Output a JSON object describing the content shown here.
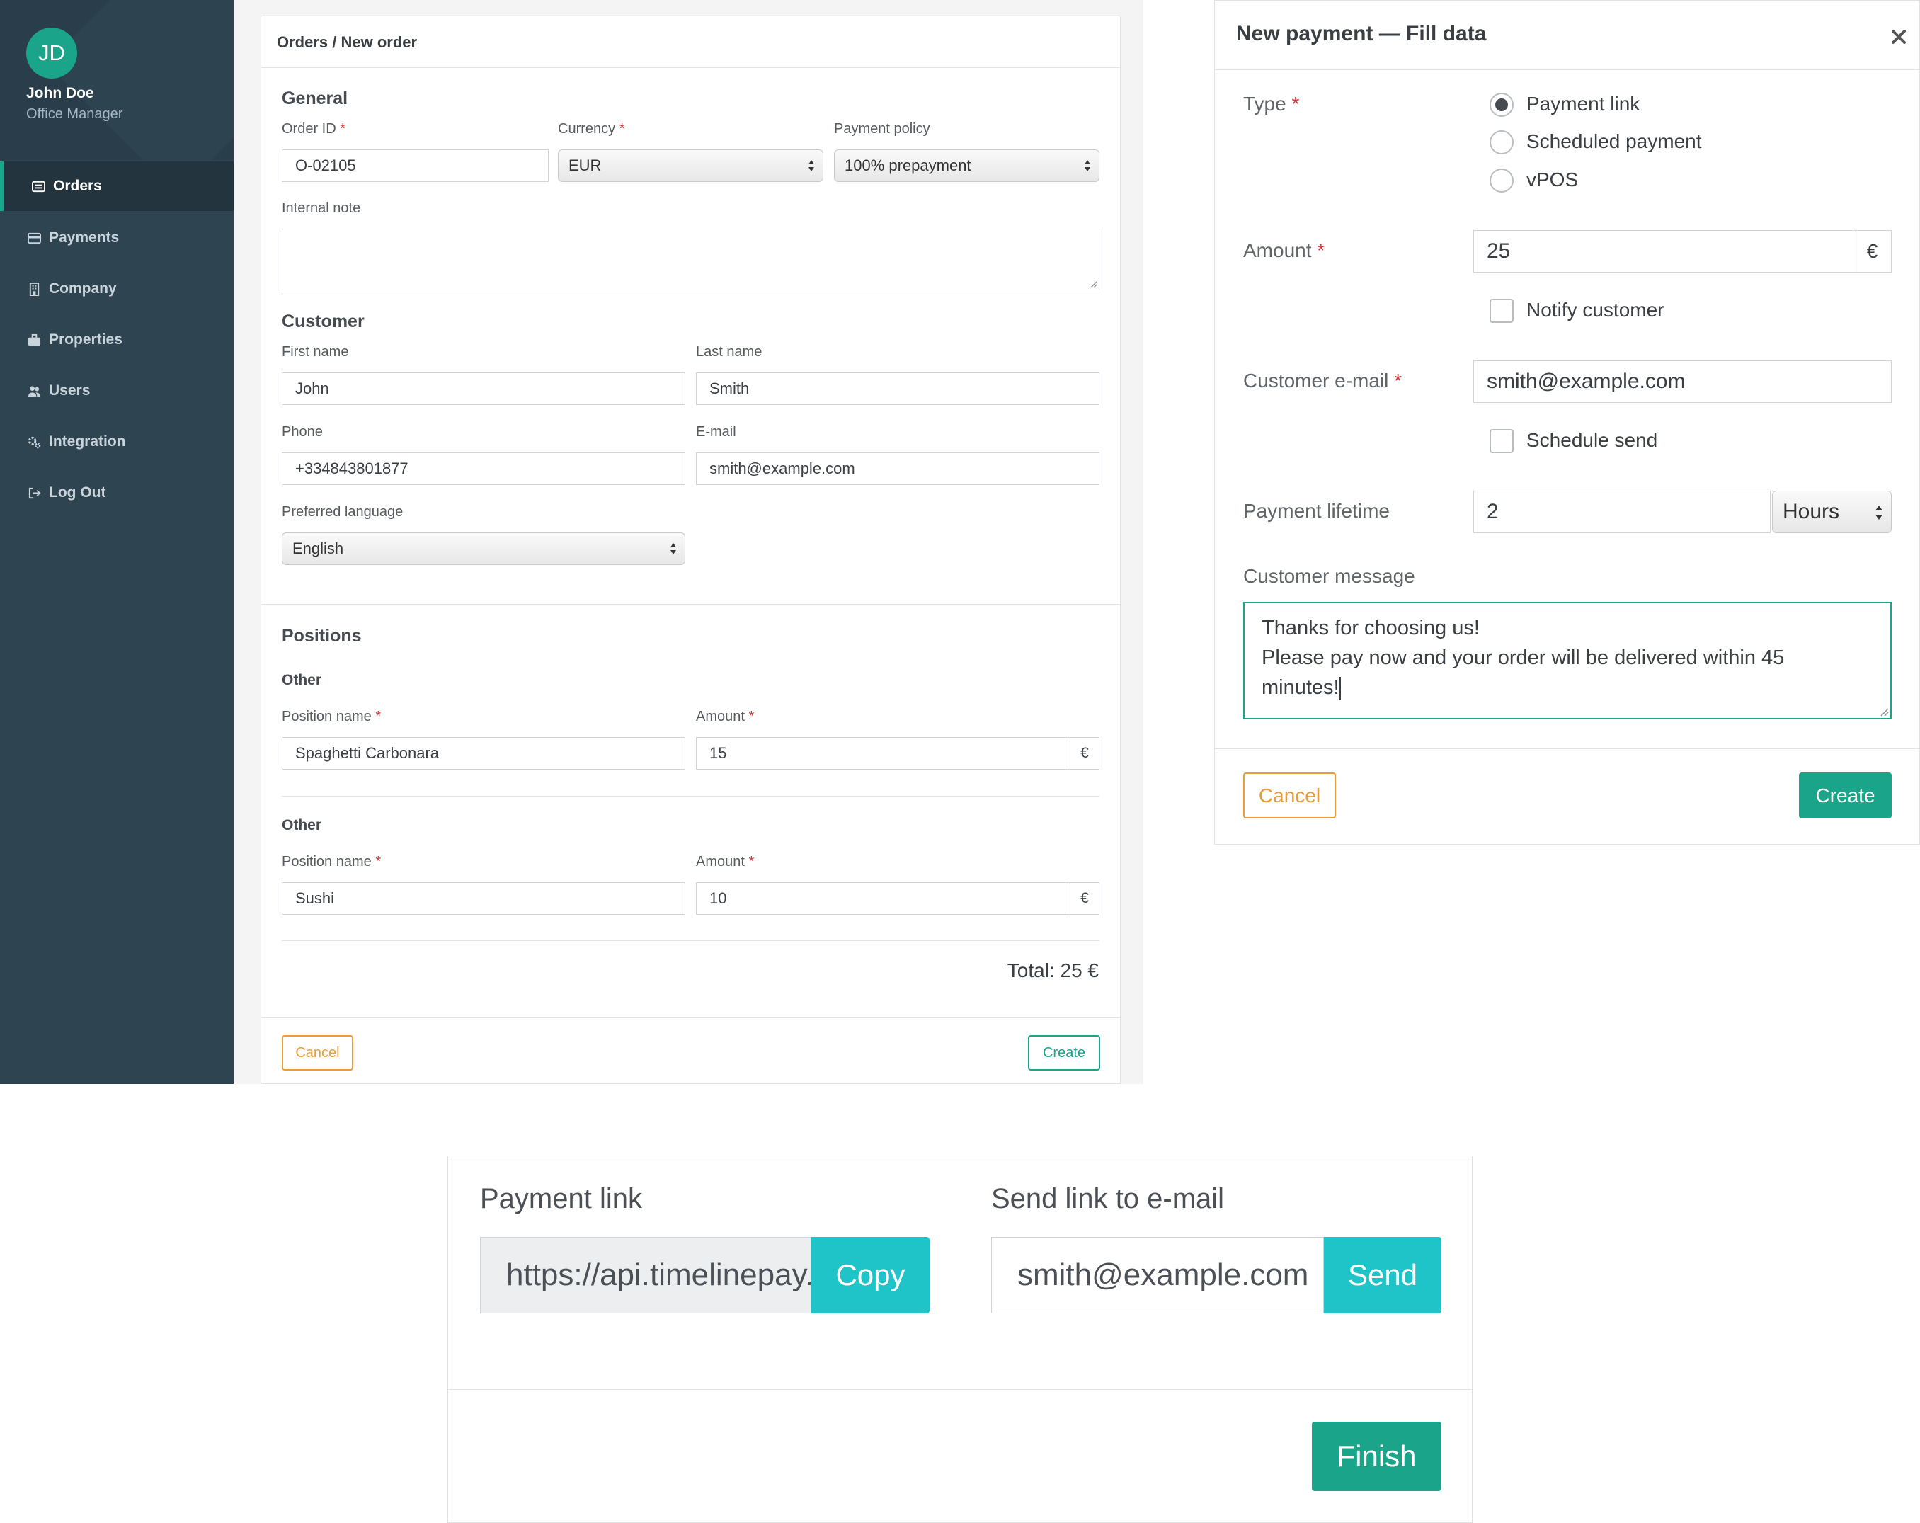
{
  "sidebar": {
    "avatar_initials": "JD",
    "user_name": "John Doe",
    "user_role": "Office Manager",
    "items": [
      {
        "label": "Orders",
        "icon": "list-icon",
        "active": true
      },
      {
        "label": "Payments",
        "icon": "credit-card-icon",
        "active": false
      },
      {
        "label": "Company",
        "icon": "building-icon",
        "active": false
      },
      {
        "label": "Properties",
        "icon": "briefcase-icon",
        "active": false
      },
      {
        "label": "Users",
        "icon": "users-icon",
        "active": false
      },
      {
        "label": "Integration",
        "icon": "cogs-icon",
        "active": false
      },
      {
        "label": "Log Out",
        "icon": "sign-out-icon",
        "active": false
      }
    ]
  },
  "order_form": {
    "breadcrumb": "Orders / New order",
    "general": {
      "title": "General",
      "order_id_label": "Order ID",
      "order_id_value": "O-02105",
      "currency_label": "Currency",
      "currency_value": "EUR",
      "policy_label": "Payment policy",
      "policy_value": "100% prepayment",
      "note_label": "Internal note"
    },
    "customer": {
      "title": "Customer",
      "first_name_label": "First name",
      "first_name_value": "John",
      "last_name_label": "Last name",
      "last_name_value": "Smith",
      "phone_label": "Phone",
      "phone_value": "+334843801877",
      "email_label": "E-mail",
      "email_value": "smith@example.com",
      "language_label": "Preferred language",
      "language_value": "English"
    },
    "positions": {
      "title": "Positions",
      "items": [
        {
          "group": "Other",
          "name_label": "Position name",
          "name_value": "Spaghetti Carbonara",
          "amount_label": "Amount",
          "amount_value": "15",
          "currency_symbol": "€"
        },
        {
          "group": "Other",
          "name_label": "Position name",
          "name_value": "Sushi",
          "amount_label": "Amount",
          "amount_value": "10",
          "currency_symbol": "€"
        }
      ],
      "total": "Total: 25 €"
    },
    "cancel_label": "Cancel",
    "create_label": "Create"
  },
  "payment_dialog": {
    "title": "New payment — Fill data",
    "type_label": "Type",
    "type_options": [
      "Payment link",
      "Scheduled payment",
      "vPOS"
    ],
    "type_selected": "Payment link",
    "amount_label": "Amount",
    "amount_value": "25",
    "currency_symbol": "€",
    "notify_label": "Notify customer",
    "email_label": "Customer e-mail",
    "email_value": "smith@example.com",
    "schedule_label": "Schedule send",
    "lifetime_label": "Payment lifetime",
    "lifetime_value": "2",
    "lifetime_unit": "Hours",
    "message_label": "Customer message",
    "message_line1": "Thanks for choosing us!",
    "message_line2": "Please pay now and your order will be delivered within 45",
    "message_line3": "minutes!",
    "cancel_label": "Cancel",
    "create_label": "Create"
  },
  "link_card": {
    "link_title": "Payment link",
    "link_value": "https://api.timelinepay.com/",
    "copy_label": "Copy",
    "email_title": "Send link to e-mail",
    "email_value": "smith@example.com",
    "send_label": "Send",
    "finish_label": "Finish"
  },
  "colors": {
    "accent": "#1aa58b",
    "warning": "#ec9c34",
    "link_button": "#1ec4c8",
    "sidebar": "#2f4451"
  }
}
